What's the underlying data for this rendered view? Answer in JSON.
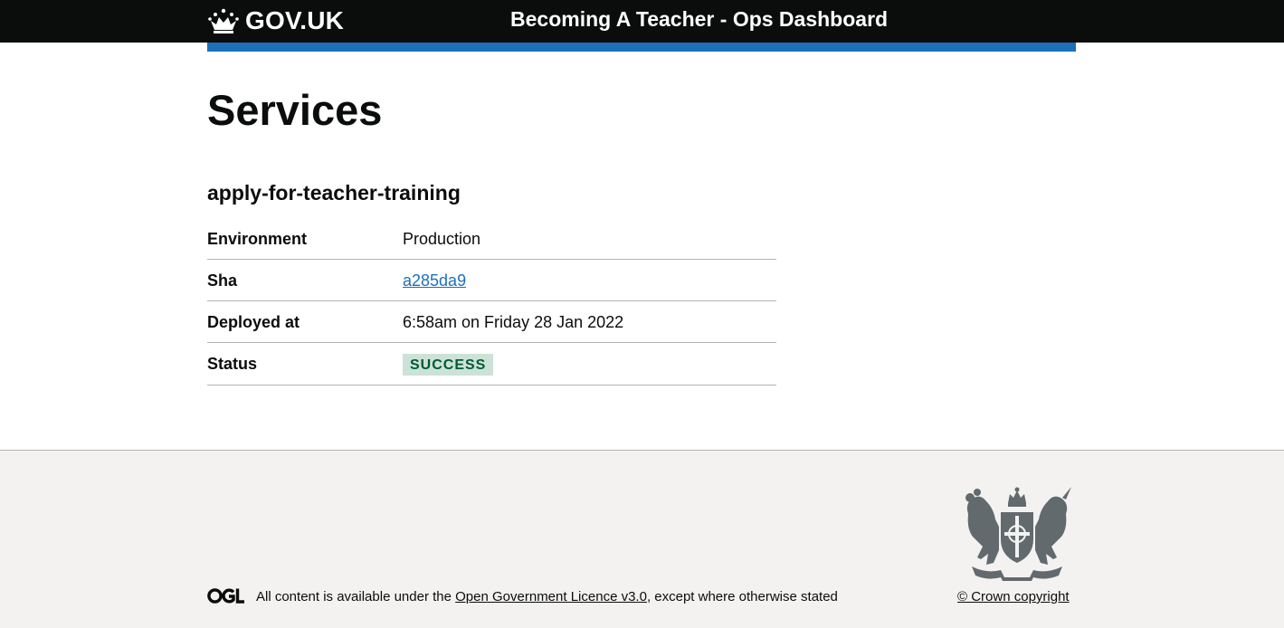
{
  "header": {
    "logo_text": "GOV.UK",
    "service_name": "Becoming A Teacher - Ops Dashboard",
    "bar_color": "#0b0c0c",
    "accent_color": "#1d70b8"
  },
  "main": {
    "page_title": "Services",
    "service": {
      "name": "apply-for-teacher-training",
      "rows": [
        {
          "key": "Environment",
          "value": "Production"
        },
        {
          "key": "Sha",
          "value": "a285da9"
        },
        {
          "key": "Deployed at",
          "value": "6:58am on Friday 28 Jan 2022"
        },
        {
          "key": "Status",
          "value": "SUCCESS"
        }
      ]
    },
    "status_colors": {
      "background": "#cce2d8",
      "text": "#005a30"
    }
  },
  "footer": {
    "licence_prefix": "All content is available under the ",
    "licence_link": "Open Government Licence v3.0",
    "licence_suffix": ", except where otherwise stated",
    "copyright": "© Crown copyright",
    "logo_icon": "ogl-logo-icon",
    "crest_icon": "royal-coat-of-arms-icon"
  }
}
